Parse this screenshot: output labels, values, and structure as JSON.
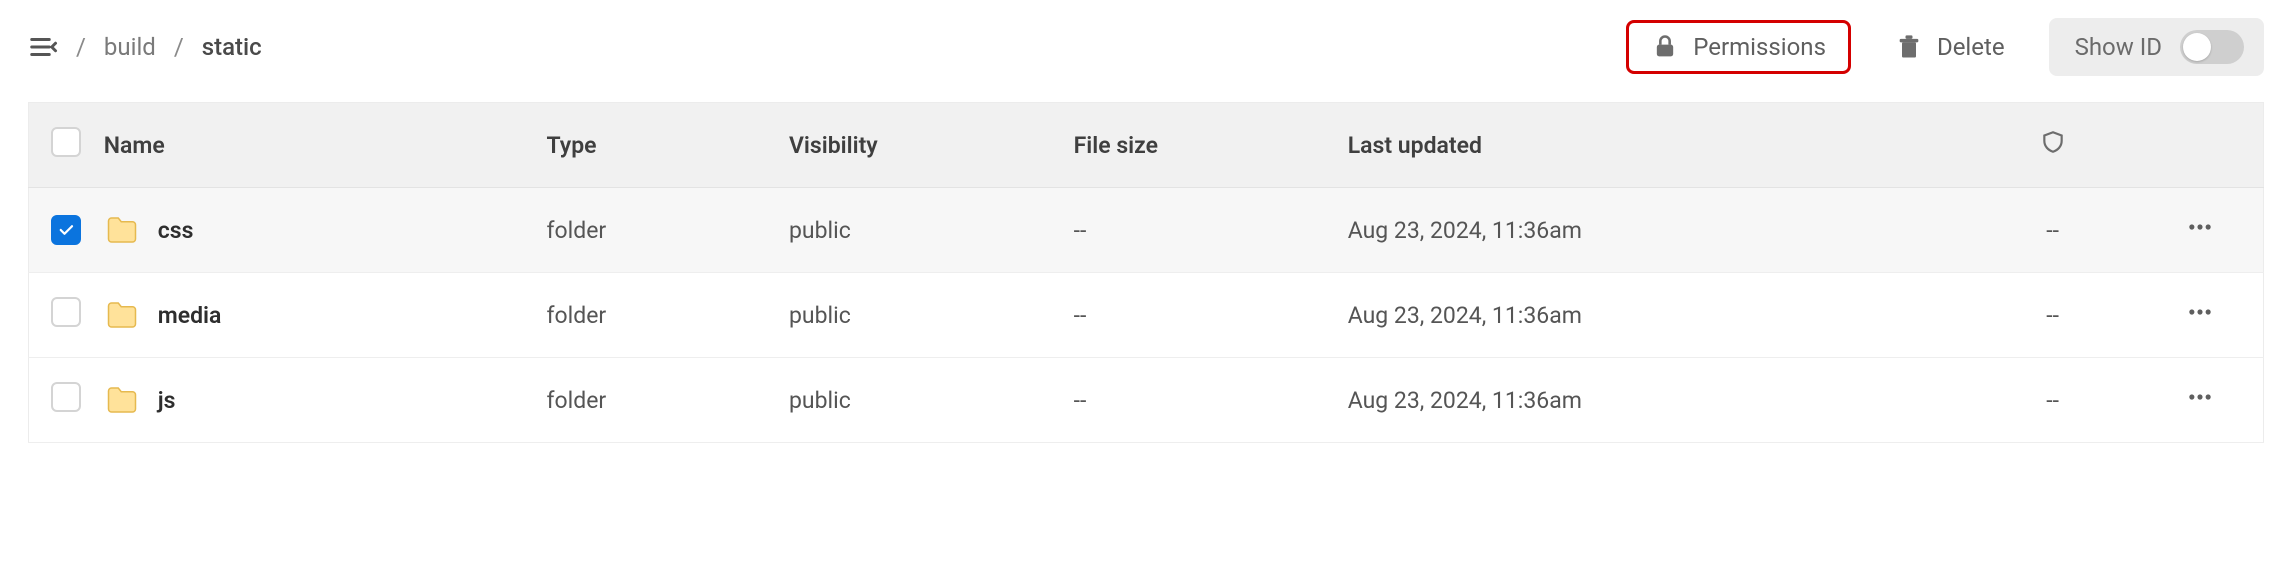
{
  "breadcrumb": {
    "items": [
      {
        "label": "build"
      },
      {
        "label": "static"
      }
    ]
  },
  "actions": {
    "permissions": "Permissions",
    "delete": "Delete",
    "show_id": "Show ID"
  },
  "columns": {
    "name": "Name",
    "type": "Type",
    "visibility": "Visibility",
    "file_size": "File size",
    "last_updated": "Last updated"
  },
  "rows": [
    {
      "selected": true,
      "name": "css",
      "type": "folder",
      "visibility": "public",
      "file_size": "--",
      "last_updated": "Aug 23, 2024, 11:36am",
      "shield": "--"
    },
    {
      "selected": false,
      "name": "media",
      "type": "folder",
      "visibility": "public",
      "file_size": "--",
      "last_updated": "Aug 23, 2024, 11:36am",
      "shield": "--"
    },
    {
      "selected": false,
      "name": "js",
      "type": "folder",
      "visibility": "public",
      "file_size": "--",
      "last_updated": "Aug 23, 2024, 11:36am",
      "shield": "--"
    }
  ]
}
